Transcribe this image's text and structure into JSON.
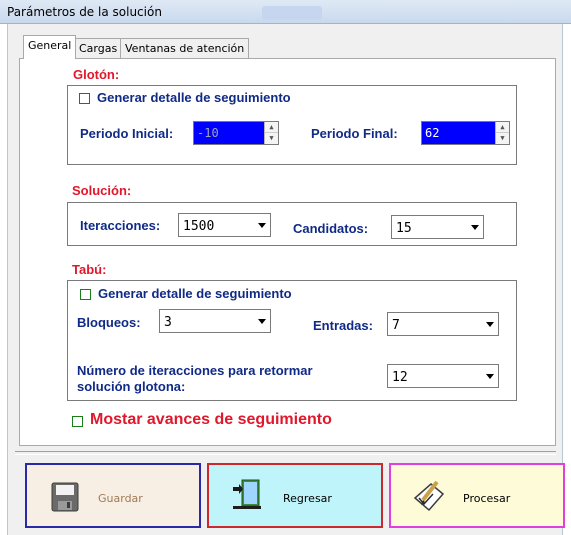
{
  "window": {
    "title": "Parámetros de la solución"
  },
  "tabs": [
    "General",
    "Cargas",
    "Ventanas de atención"
  ],
  "active_tab": "General",
  "sections": {
    "gloton": {
      "title": "Glotón:",
      "detail_checkbox": {
        "label": "Generar detalle de seguimiento",
        "checked": false
      },
      "periodo_inicial": {
        "label": "Periodo Inicial:",
        "value": "-10",
        "enabled": false
      },
      "periodo_final": {
        "label": "Periodo Final:",
        "value": "62",
        "enabled": true
      }
    },
    "solucion": {
      "title": "Solución:",
      "iteracciones": {
        "label": "Iteracciones:",
        "value": "1500"
      },
      "candidatos": {
        "label": "Candidatos:",
        "value": "15"
      }
    },
    "tabu": {
      "title": "Tabú:",
      "detail_checkbox": {
        "label": "Generar detalle de seguimiento",
        "checked": false
      },
      "bloqueos": {
        "label": "Bloqueos:",
        "value": "3"
      },
      "entradas": {
        "label": "Entradas:",
        "value": "7"
      },
      "retornar": {
        "label_line1": "Número de iteracciones para retormar",
        "label_line2": "solución glotona:",
        "value": "12"
      }
    }
  },
  "mostrar_checkbox": {
    "label": "Mostar avances de seguimiento",
    "checked": false
  },
  "actions": {
    "guardar": {
      "label": "Guardar",
      "border": "#2a2aa6",
      "bg": "#f8efe4"
    },
    "regresar": {
      "label": "Regresar",
      "border": "#cc2a2a",
      "bg": "#bff4fb"
    },
    "procesar": {
      "label": "Procesar",
      "border": "#e040e0",
      "bg": "#fdfbd8"
    }
  },
  "colors": {
    "section_title": "#e0182c",
    "field_label": "#102a86",
    "spin_bg": "#0000ff",
    "checkbox_border": "#1a7f1a"
  },
  "icons": {
    "guardar": "floppy-disk-icon",
    "regresar": "door-exit-icon",
    "procesar": "pen-and-check-icon"
  }
}
